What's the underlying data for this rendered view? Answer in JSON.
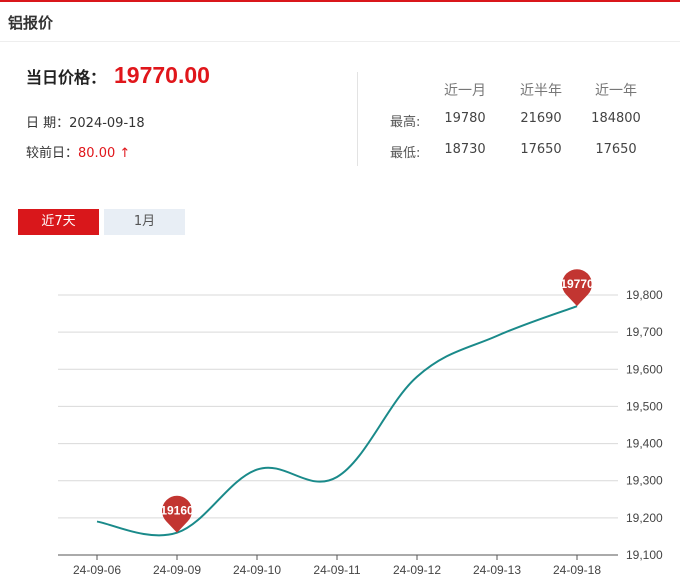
{
  "header": {
    "title": "铝报价"
  },
  "price": {
    "label": "当日价格：",
    "value": "19770.00",
    "date": "日 期：2024-09-18",
    "change_label": "较前日：",
    "change_value": "80.00 ↑"
  },
  "stats": {
    "headers": [
      "近一月",
      "近半年",
      "近一年"
    ],
    "rows": [
      {
        "label": "最高:",
        "values": [
          "19780",
          "21690",
          "184800"
        ]
      },
      {
        "label": "最低:",
        "values": [
          "18730",
          "17650",
          "17650"
        ]
      }
    ]
  },
  "tabs": [
    {
      "label": "近7天",
      "active": true
    },
    {
      "label": "1月",
      "active": false
    }
  ],
  "chart_data": {
    "type": "line",
    "x": [
      "24-09-06",
      "24-09-09",
      "24-09-10",
      "24-09-11",
      "24-09-12",
      "24-09-13",
      "24-09-18"
    ],
    "values": [
      19190,
      19160,
      19330,
      19310,
      19580,
      19690,
      19770
    ],
    "ylim": [
      19100,
      19800
    ],
    "yticks": [
      19100,
      19200,
      19300,
      19400,
      19500,
      19600,
      19700,
      19800
    ],
    "ytick_labels": [
      "19,100",
      "19,200",
      "19,300",
      "19,400",
      "19,500",
      "19,600",
      "19,700",
      "19,800"
    ],
    "markers": [
      {
        "index": 1,
        "label": "19160"
      },
      {
        "index": 6,
        "label": "19770"
      }
    ],
    "line_color": "#1a8a8a",
    "marker_color": "#c23531",
    "grid": true
  }
}
